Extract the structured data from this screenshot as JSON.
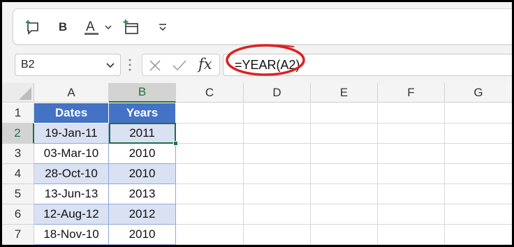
{
  "toolbar": {
    "items": [
      {
        "name": "new-comment-icon"
      },
      {
        "name": "bold-button",
        "label": "B"
      },
      {
        "name": "font-color-icon",
        "label": "A"
      },
      {
        "name": "chevron-down-icon"
      },
      {
        "name": "insert-table-icon"
      },
      {
        "name": "customize-toolbar-icon"
      }
    ]
  },
  "formula_bar": {
    "name_box": "B2",
    "fx_label": "fx",
    "formula": "=YEAR(A2)"
  },
  "columns": [
    "A",
    "B",
    "C",
    "D",
    "E",
    "F",
    "G"
  ],
  "selected_column": "B",
  "rows": [
    "1",
    "2",
    "3",
    "4",
    "5",
    "6",
    "7"
  ],
  "selected_row": "2",
  "table": {
    "headers": [
      "Dates",
      "Years"
    ],
    "data": [
      [
        "19-Jan-11",
        "2011"
      ],
      [
        "03-Mar-10",
        "2010"
      ],
      [
        "28-Oct-10",
        "2010"
      ],
      [
        "13-Jun-13",
        "2013"
      ],
      [
        "12-Aug-12",
        "2012"
      ],
      [
        "18-Nov-10",
        "2010"
      ]
    ]
  },
  "colors": {
    "header_fill": "#4472c4",
    "band_fill": "#d9e1f2",
    "selection": "#1e7145",
    "annotation_circle": "#e02020"
  }
}
